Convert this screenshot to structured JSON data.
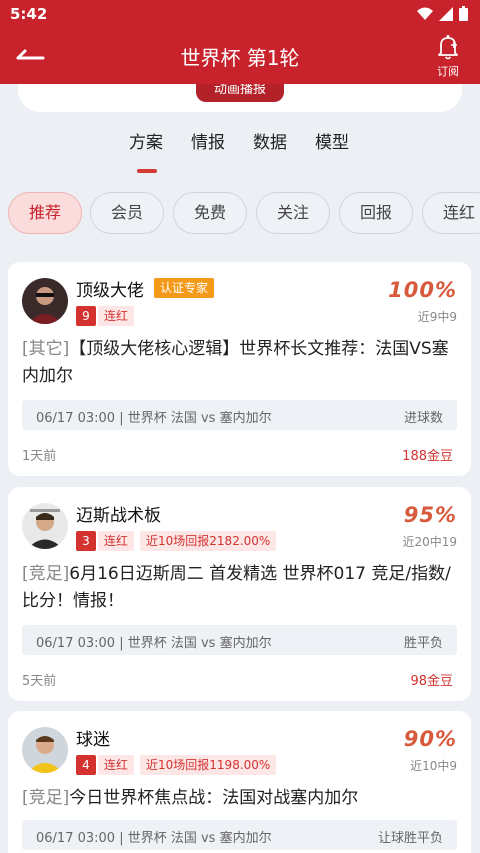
{
  "status": {
    "time": "5:42"
  },
  "appbar": {
    "title": "世界杯 第1轮",
    "subscribe_label": "订阅"
  },
  "header": {
    "anim_label": "动画播报"
  },
  "tabs": [
    "方案",
    "情报",
    "数据",
    "模型"
  ],
  "chips": [
    "推荐",
    "会员",
    "免费",
    "关注",
    "回报",
    "连红"
  ],
  "cards": [
    {
      "name": "顶级大佬",
      "badge": "认证专家",
      "streak_num": "9",
      "streak_label": "连红",
      "return_label": "",
      "rate": "100%",
      "rate_sub": "近9中9",
      "tag": "[其它]",
      "content": "【顶级大佬核心逻辑】世界杯长文推荐：法国VS塞内加尔",
      "match_info": "06/17 03:00 | 世界杯 法国 vs 塞内加尔",
      "match_type": "进球数",
      "time_ago": "1天前",
      "price": "188金豆"
    },
    {
      "name": "迈斯战术板",
      "badge": "",
      "streak_num": "3",
      "streak_label": "连红",
      "return_label": "近10场回报2182.00%",
      "rate": "95%",
      "rate_sub": "近20中19",
      "tag": "[竞足]",
      "content": "6月16日迈斯周二 首发精选 世界杯017 竞足/指数/比分！情报！",
      "match_info": "06/17 03:00 | 世界杯 法国 vs 塞内加尔",
      "match_type": "胜平负",
      "time_ago": "5天前",
      "price": "98金豆"
    },
    {
      "name": "球迷",
      "badge": "",
      "streak_num": "4",
      "streak_label": "连红",
      "return_label": "近10场回报1198.00%",
      "rate": "90%",
      "rate_sub": "近10中9",
      "tag": "[竞足]",
      "content": "今日世界杯焦点战：法国对战塞内加尔",
      "match_info": "06/17 03:00 | 世界杯 法国 vs 塞内加尔",
      "match_type": "让球胜平负",
      "time_ago": "",
      "price": ""
    }
  ]
}
